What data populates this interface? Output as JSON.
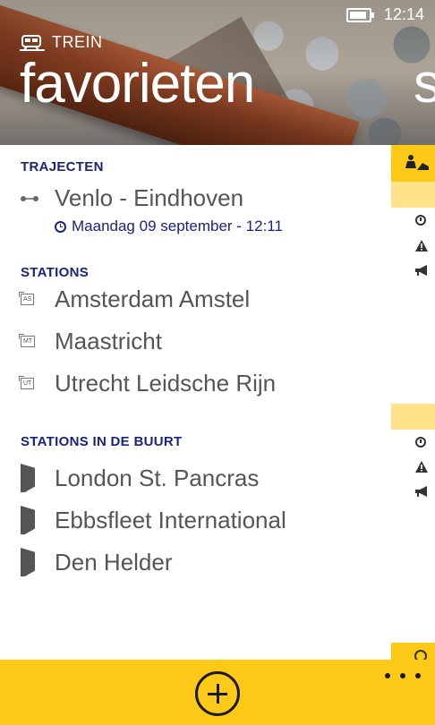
{
  "status_bar": {
    "time": "12:14",
    "battery_icon": "battery-charging-icon"
  },
  "header": {
    "app_name": "TREIN",
    "app_icon": "train-icon",
    "page_title": "favorieten",
    "next_page_peek": "s"
  },
  "sections": {
    "trajecten": {
      "header": "TRAJECTEN",
      "items": [
        {
          "label": "Venlo - Eindhoven",
          "icon": "route-icon",
          "subtitle": "Maandag 09 september - 12:11",
          "subtitle_icon": "clock-icon"
        }
      ]
    },
    "stations": {
      "header": "STATIONS",
      "items": [
        {
          "code": "AS",
          "label": "Amsterdam Amstel"
        },
        {
          "code": "MT",
          "label": "Maastricht"
        },
        {
          "code": "UT",
          "label": "Utrecht Leidsche Rijn"
        }
      ]
    },
    "nearby": {
      "header": "STATIONS IN DE BUURT",
      "items": [
        {
          "label": "London St. Pancras",
          "icon": "flag-icon"
        },
        {
          "label": "Ebbsfleet International",
          "icon": "flag-icon"
        },
        {
          "label": "Den Helder",
          "icon": "flag-icon"
        }
      ]
    }
  },
  "right_strip": {
    "icons": [
      "construction-worker-icon",
      "clock-icon",
      "warning-icon",
      "megaphone-icon",
      "clock-icon",
      "warning-icon",
      "megaphone-icon",
      "clock-icon"
    ],
    "colors": {
      "accent": "#ffc917",
      "accent_light": "#ffe28a"
    }
  },
  "app_bar": {
    "add_icon": "add-icon",
    "more_icon": "more-icon",
    "background": "#ffc917"
  },
  "colors": {
    "section_header": "#1a237e",
    "item_text": "#555555"
  }
}
